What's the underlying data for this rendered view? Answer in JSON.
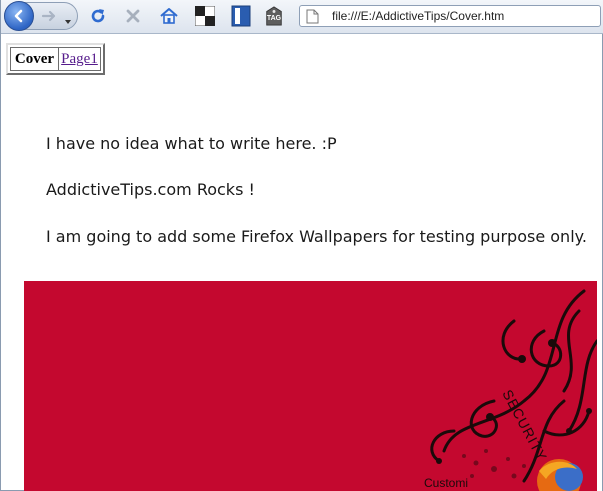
{
  "browser": {
    "url": "file:///E:/AddictiveTips/Cover.htm",
    "toolbar_icons": [
      "back-icon",
      "forward-icon",
      "history-dropdown-icon",
      "reload-icon",
      "stop-icon",
      "home-icon",
      "checker-icon",
      "bookmark-icon",
      "tag-icon",
      "page-icon"
    ],
    "tag_label": "TAG"
  },
  "nav_table": {
    "cover_label": "Cover",
    "page1_label": "Page1"
  },
  "content": {
    "line1": "I have no idea what to write here. :P",
    "line2": "AddictiveTips.com Rocks !",
    "line3": "I am going to add some Firefox Wallpapers for testing purpose only."
  },
  "wallpaper": {
    "word_security": "SECURITY",
    "word_custom": "Customi",
    "background_color": "#c4082f",
    "swirl_color": "#1a0a0a"
  }
}
